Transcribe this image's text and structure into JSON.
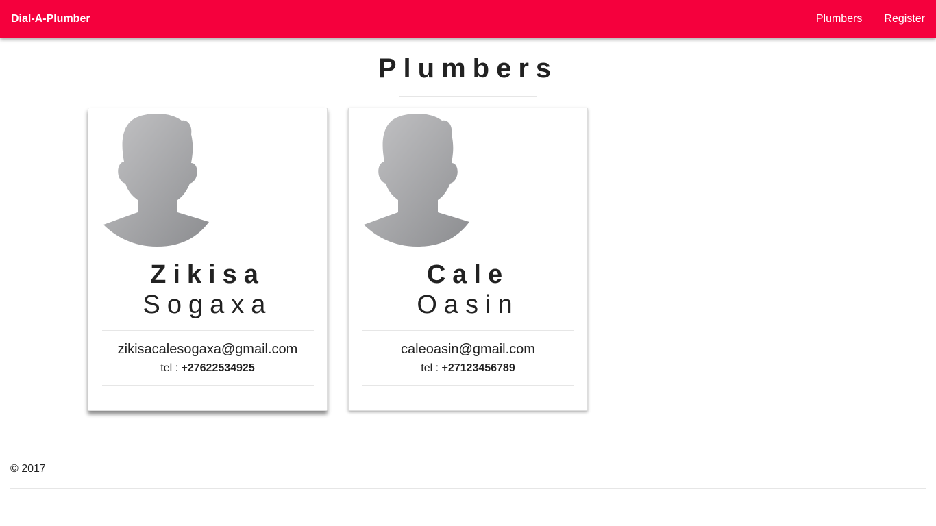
{
  "navbar": {
    "brand": "Dial-A-Plumber",
    "links": [
      "Plumbers",
      "Register"
    ],
    "background": "#f5003d"
  },
  "page": {
    "title": "Plumbers"
  },
  "plumbers": [
    {
      "avatar_icon": "user-silhouette-icon",
      "first_name": "Zikisa",
      "last_name": "Sogaxa",
      "email": "zikisacalesogaxa@gmail.com",
      "tel_label": "tel :",
      "tel": "+27622534925"
    },
    {
      "avatar_icon": "user-silhouette-icon",
      "first_name": "Cale",
      "last_name": "Oasin",
      "email": "caleoasin@gmail.com",
      "tel_label": "tel :",
      "tel": "+27123456789"
    }
  ],
  "footer": {
    "text": "© 2017"
  }
}
